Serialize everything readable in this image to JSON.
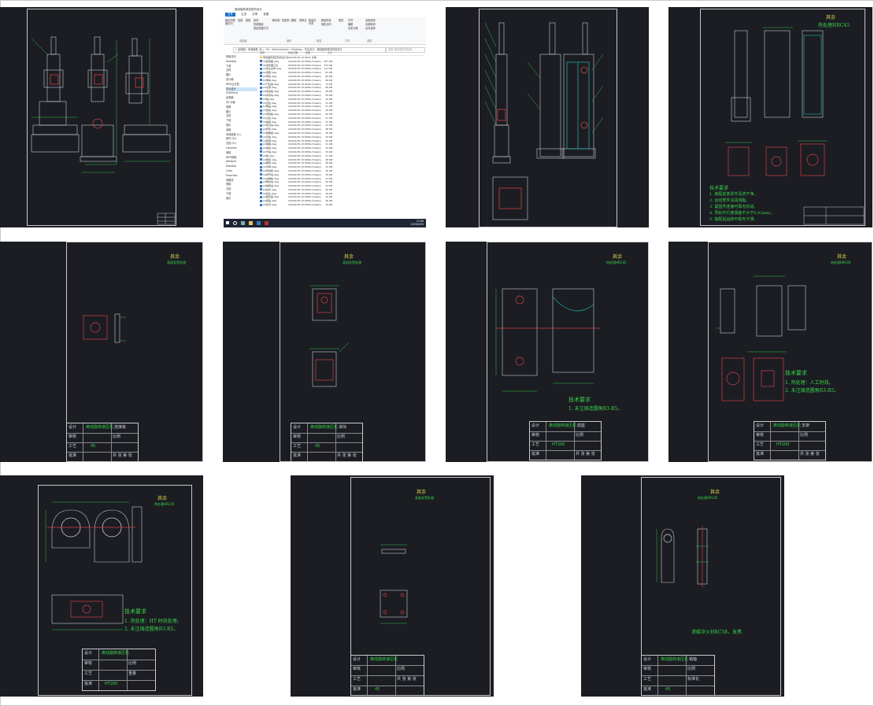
{
  "explorer": {
    "title": "离线旋转滚压机的设计",
    "tabs": [
      "文件",
      "主页",
      "共享",
      "查看"
    ],
    "ribbon_groups": [
      "固定到快速访问",
      "复制",
      "粘贴",
      "剪切",
      "复制路径",
      "粘贴快捷方式",
      "移动到",
      "复制到",
      "删除",
      "重命名",
      "新建文件夹",
      "新建项目",
      "轻松访问",
      "属性",
      "打开",
      "编辑",
      "历史记录",
      "全部选择",
      "全部取消",
      "反向选择"
    ],
    "ribbon_sections": [
      "剪贴板",
      "组织",
      "新建",
      "打开",
      "选择"
    ],
    "address": "« 此电脑 › 本地磁盘 (D:) › 00 › Administrator › Desktop › 毕业设计 › 离线旋转滚压机的设计",
    "search_placeholder": "搜索\"离线旋转滚压机...\"",
    "columns": [
      "名称",
      "修改日期",
      "类型",
      "大小"
    ],
    "nav_items": [
      "快速访问",
      "Desktop",
      "下载",
      "文档",
      "图片",
      "设计稿",
      "WPS云文档",
      "毕业设计",
      "OneDrive",
      "此电脑",
      "3D 对象",
      "视频",
      "图片",
      "文档",
      "下载",
      "音乐",
      "桌面",
      "本地磁盘 (C:)",
      "软件 (D:)",
      "文档 (E:)",
      "Libraries",
      "网络",
      "WPS网盘",
      "Network",
      "Desktop",
      "Links",
      "Favorites",
      "收藏夹",
      "视频",
      "文档",
      "下载",
      "音乐"
    ],
    "files": [
      {
        "name": "离线旋转滚压机的设计说明书",
        "date": "2020/4/30 15:04",
        "type": "DOC 文档",
        "size": ""
      },
      {
        "name": "A0装配图.dwg",
        "date": "2020/4/30 15:02",
        "type": "DWG Drawing",
        "size": "457 KB"
      },
      {
        "name": "A0零件图汇总",
        "date": "2020/4/30 15:02",
        "type": "DWG Drawing",
        "size": "372 KB"
      },
      {
        "name": "A1压头总成.dwg",
        "date": "2020/4/30 15:02",
        "type": "DWG Drawing",
        "size": "211 KB"
      },
      {
        "name": "A2底座.dwg",
        "date": "2020/4/30 15:02",
        "type": "DWG Drawing",
        "size": "81 KB"
      },
      {
        "name": "A3导轨.dwg",
        "date": "2020/4/30 15:02",
        "type": "DWG Drawing",
        "size": "62 KB"
      },
      {
        "name": "A3滑块.dwg",
        "date": "2020/4/30 15:02",
        "type": "DWG Drawing",
        "size": "58 KB"
      },
      {
        "name": "A3气缸座.dwg",
        "date": "2020/4/30 15:02",
        "type": "DWG Drawing",
        "size": "73 KB"
      },
      {
        "name": "A3支架.dwg",
        "date": "2020/4/30 15:02",
        "type": "DWG Drawing",
        "size": "66 KB"
      },
      {
        "name": "A3连接板.dwg",
        "date": "2020/4/30 15:02",
        "type": "DWG Drawing",
        "size": "49 KB"
      },
      {
        "name": "A3夹紧块.dwg",
        "date": "2020/4/30 15:02",
        "type": "DWG Drawing",
        "size": "55 KB"
      },
      {
        "name": "A3轴.dwg",
        "date": "2020/4/30 15:02",
        "type": "DWG Drawing",
        "size": "44 KB"
      },
      {
        "name": "A3压轮.dwg",
        "date": "2020/4/30 15:02",
        "type": "DWG Drawing",
        "size": "51 KB"
      },
      {
        "name": "A3端盖.dwg",
        "date": "2020/4/30 15:02",
        "type": "DWG Drawing",
        "size": "47 KB"
      },
      {
        "name": "A3垫板.dwg",
        "date": "2020/4/30 15:02",
        "type": "DWG Drawing",
        "size": "39 KB"
      },
      {
        "name": "A3安装板.dwg",
        "date": "2020/4/30 15:02",
        "type": "DWG Drawing",
        "size": "60 KB"
      },
      {
        "name": "A3立柱.dwg",
        "date": "2020/4/30 15:02",
        "type": "DWG Drawing",
        "size": "57 KB"
      },
      {
        "name": "A3横梁.dwg",
        "date": "2020/4/30 15:02",
        "type": "DWG Drawing",
        "size": "53 KB"
      },
      {
        "name": "A3定位块.dwg",
        "date": "2020/4/30 15:02",
        "type": "DWG Drawing",
        "size": "41 KB"
      },
      {
        "name": "A3套筒.dwg",
        "date": "2020/4/30 15:02",
        "type": "DWG Drawing",
        "size": "38 KB"
      },
      {
        "name": "A3弹簧座.dwg",
        "date": "2020/4/30 15:02",
        "type": "DWG Drawing",
        "size": "36 KB"
      },
      {
        "name": "A4压板.dwg",
        "date": "2020/4/30 15:02",
        "type": "DWG Drawing",
        "size": "34 KB"
      },
      {
        "name": "A4垫圈.dwg",
        "date": "2020/4/30 15:02",
        "type": "DWG Drawing",
        "size": "29 KB"
      },
      {
        "name": "A4销轴.dwg",
        "date": "2020/4/30 15:02",
        "type": "DWG Drawing",
        "size": "31 KB"
      },
      {
        "name": "A4挡块.dwg",
        "date": "2020/4/30 15:02",
        "type": "DWG Drawing",
        "size": "33 KB"
      },
      {
        "name": "A4卡箍.dwg",
        "date": "2020/4/30 15:02",
        "type": "DWG Drawing",
        "size": "30 KB"
      },
      {
        "name": "A4键.dwg",
        "date": "2020/4/30 15:02",
        "type": "DWG Drawing",
        "size": "27 KB"
      },
      {
        "name": "A4隔套.dwg",
        "date": "2020/4/30 15:02",
        "type": "DWG Drawing",
        "size": "28 KB"
      },
      {
        "name": "A4螺母.dwg",
        "date": "2020/4/30 15:02",
        "type": "DWG Drawing",
        "size": "26 KB"
      },
      {
        "name": "A4手柄.dwg",
        "date": "2020/4/30 15:02",
        "type": "DWG Drawing",
        "size": "32 KB"
      },
      {
        "name": "A4导向套.dwg",
        "date": "2020/4/30 15:02",
        "type": "DWG Drawing",
        "size": "35 KB"
      },
      {
        "name": "A4调节块.dwg",
        "date": "2020/4/30 15:02",
        "type": "DWG Drawing",
        "size": "34 KB"
      },
      {
        "name": "A4支撑板.dwg",
        "date": "2020/4/30 15:02",
        "type": "DWG Drawing",
        "size": "37 KB"
      },
      {
        "name": "A4限位块.dwg",
        "date": "2020/4/30 15:02",
        "type": "DWG Drawing",
        "size": "30 KB"
      },
      {
        "name": "A4轴承盖.dwg",
        "date": "2020/4/30 15:02",
        "type": "DWG Drawing",
        "size": "31 KB"
      },
      {
        "name": "A4拉杆.dwg",
        "date": "2020/4/30 15:02",
        "type": "DWG Drawing",
        "size": "29 KB"
      },
      {
        "name": "A4接头.dwg",
        "date": "2020/4/30 15:02",
        "type": "DWG Drawing",
        "size": "28 KB"
      },
      {
        "name": "A4固定座.dwg",
        "date": "2020/4/30 15:02",
        "type": "DWG Drawing",
        "size": "33 KB"
      },
      {
        "name": "A4底板.dwg",
        "date": "2020/4/30 15:02",
        "type": "DWG Drawing",
        "size": "36 KB"
      },
      {
        "name": "A4护罩.dwg",
        "date": "2020/4/30 15:02",
        "type": "DWG Drawing",
        "size": "34 KB"
      }
    ],
    "status": "41 个项目",
    "clock_time": "15:06",
    "clock_date": "2020/4/30"
  },
  "drawings": {
    "tech_requirements_title": "技术要求",
    "note_heat_treatment_1": "1. 热处理：人工时效。",
    "note_heat_treatment_2": "1. 热处理：HT 时效处理。",
    "note_fillet": "2. 未注铸造圆角R3-R5。",
    "note_fillet_single": "1. 未注铸造圆角R3-R5。",
    "note_finish": "表面发黑处理",
    "assembly_note_1": "1. 装配前各零件清洗干净。",
    "assembly_note_2": "2. 运动部件涂润滑脂。",
    "assembly_note_3": "3. 紧固件连接可靠无松动。",
    "assembly_note_4": "4. 导轨平行度误差不大于0.02mm。",
    "assembly_note_5": "5. 装配后运转平稳无卡滞。",
    "other_roughness": "其余",
    "hardness_note": "热处理HRC45",
    "part_note": "渗碳淬火HRC58，发黑",
    "tb_design": "设计",
    "tb_check": "审核",
    "tb_process": "工艺",
    "tb_approve": "批准",
    "tb_standard": "标准化",
    "tb_scale": "比例",
    "tb_weight": "重量",
    "tb_sheet": "共  张  第  张",
    "tb_school": "离线旋转滚压机",
    "tb_material_ht": "HT200",
    "tb_material_45": "45",
    "tb_part_base": "底座",
    "tb_part_slider": "滑块",
    "tb_part_bracket": "支架",
    "tb_part_plate": "连接板",
    "tb_part_shaft": "销轴"
  }
}
